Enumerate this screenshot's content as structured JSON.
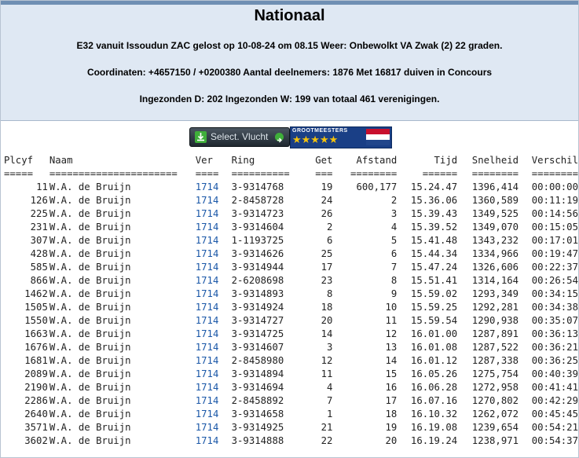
{
  "header": {
    "title": "Nationaal",
    "line1": "E32 vanuit Issoudun ZAC gelost op 10-08-24 om 08.15 Weer: Onbewolkt VA Zwak (2) 22 graden.",
    "line2": "Coordinaten: +4657150 / +0200380 Aantal deelnemers: 1876 Met 16817 duiven in Concours",
    "line3": "Ingezonden D: 202 Ingezonden W: 199 van totaal 461 verenigingen."
  },
  "buttons": {
    "select_flight": "Select. Vlucht",
    "grootmeesters": "GROOTMEESTERS",
    "stars": "★★★★★"
  },
  "colors": {
    "header_bg": "#dfe8f3",
    "link": "#1b58a8",
    "flag": [
      "#c8102e",
      "#ffffff",
      "#21468b"
    ]
  },
  "table": {
    "headers": [
      "Plcyf",
      "Naam",
      "Ver",
      "Ring",
      "Get",
      "Afstand",
      "Tijd",
      "Snelheid",
      "Verschil"
    ],
    "separators": [
      "=====",
      "======================",
      "====",
      "==========",
      "===",
      "========",
      "======",
      "========",
      "========"
    ],
    "rows": [
      [
        "11",
        "W.A. de Bruijn",
        "1714",
        "3-9314768",
        "19",
        "600,177",
        "15.24.47",
        "1396,414",
        "00:00:00"
      ],
      [
        "126",
        "W.A. de Bruijn",
        "1714",
        "2-8458728",
        "24",
        "2",
        "15.36.06",
        "1360,589",
        "00:11:19"
      ],
      [
        "225",
        "W.A. de Bruijn",
        "1714",
        "3-9314723",
        "26",
        "3",
        "15.39.43",
        "1349,525",
        "00:14:56"
      ],
      [
        "231",
        "W.A. de Bruijn",
        "1714",
        "3-9314604",
        "2",
        "4",
        "15.39.52",
        "1349,070",
        "00:15:05"
      ],
      [
        "307",
        "W.A. de Bruijn",
        "1714",
        "1-1193725",
        "6",
        "5",
        "15.41.48",
        "1343,232",
        "00:17:01"
      ],
      [
        "428",
        "W.A. de Bruijn",
        "1714",
        "3-9314626",
        "25",
        "6",
        "15.44.34",
        "1334,966",
        "00:19:47"
      ],
      [
        "585",
        "W.A. de Bruijn",
        "1714",
        "3-9314944",
        "17",
        "7",
        "15.47.24",
        "1326,606",
        "00:22:37"
      ],
      [
        "866",
        "W.A. de Bruijn",
        "1714",
        "2-6208698",
        "23",
        "8",
        "15.51.41",
        "1314,164",
        "00:26:54"
      ],
      [
        "1462",
        "W.A. de Bruijn",
        "1714",
        "3-9314893",
        "8",
        "9",
        "15.59.02",
        "1293,349",
        "00:34:15"
      ],
      [
        "1505",
        "W.A. de Bruijn",
        "1714",
        "3-9314924",
        "18",
        "10",
        "15.59.25",
        "1292,281",
        "00:34:38"
      ],
      [
        "1550",
        "W.A. de Bruijn",
        "1714",
        "3-9314727",
        "20",
        "11",
        "15.59.54",
        "1290,938",
        "00:35:07"
      ],
      [
        "1663",
        "W.A. de Bruijn",
        "1714",
        "3-9314725",
        "14",
        "12",
        "16.01.00",
        "1287,891",
        "00:36:13"
      ],
      [
        "1676",
        "W.A. de Bruijn",
        "1714",
        "3-9314607",
        "3",
        "13",
        "16.01.08",
        "1287,522",
        "00:36:21"
      ],
      [
        "1681",
        "W.A. de Bruijn",
        "1714",
        "2-8458980",
        "12",
        "14",
        "16.01.12",
        "1287,338",
        "00:36:25"
      ],
      [
        "2089",
        "W.A. de Bruijn",
        "1714",
        "3-9314894",
        "11",
        "15",
        "16.05.26",
        "1275,754",
        "00:40:39"
      ],
      [
        "2190",
        "W.A. de Bruijn",
        "1714",
        "3-9314694",
        "4",
        "16",
        "16.06.28",
        "1272,958",
        "00:41:41"
      ],
      [
        "2286",
        "W.A. de Bruijn",
        "1714",
        "2-8458892",
        "7",
        "17",
        "16.07.16",
        "1270,802",
        "00:42:29"
      ],
      [
        "2640",
        "W.A. de Bruijn",
        "1714",
        "3-9314658",
        "1",
        "18",
        "16.10.32",
        "1262,072",
        "00:45:45"
      ],
      [
        "3571",
        "W.A. de Bruijn",
        "1714",
        "3-9314925",
        "21",
        "19",
        "16.19.08",
        "1239,654",
        "00:54:21"
      ],
      [
        "3602",
        "W.A. de Bruijn",
        "1714",
        "3-9314888",
        "22",
        "20",
        "16.19.24",
        "1238,971",
        "00:54:37"
      ]
    ]
  }
}
